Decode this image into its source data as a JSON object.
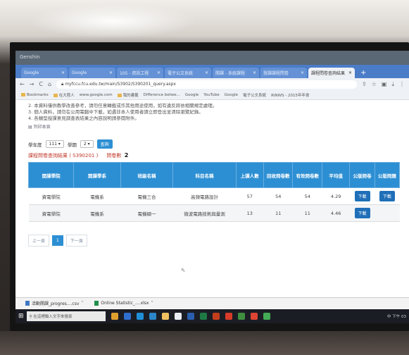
{
  "os": {
    "title": "Genshin"
  },
  "browser": {
    "tabs": [
      {
        "label": "Google",
        "active": false
      },
      {
        "label": "Google",
        "active": false
      },
      {
        "label": "105 - 資訊工程",
        "active": false
      },
      {
        "label": "電子公文系統",
        "active": false
      },
      {
        "label": "開課 - 系統課程",
        "active": false
      },
      {
        "label": "授課課程問卷",
        "active": false
      },
      {
        "label": "課程問卷查詢結果",
        "active": true
      }
    ],
    "url": "myfccu.fcu.edu.tw/main/S3902/S390201_query.aspx",
    "bookmarks": [
      "Bookmarks",
      "在大陸人",
      "www.google.com",
      "我的書籤",
      "Difference betwe...",
      "Google",
      "YouTube",
      "Google",
      "電子公文系統",
      "RINWS - 2015年年會"
    ]
  },
  "page": {
    "notes": [
      "2. 本資料僅供教學改善參考，請勿任意轉載或作其他用途使用，如有違反將依相關規定處理。",
      "3. 個人資料，請勿在公用電腦中下載，如遇非本人使用者請立即登出並清除瀏覽紀錄。",
      "4. 各類型授課意見調查表結果之內容說明請參閱附件。"
    ],
    "print_label": "列印本頁",
    "filters": {
      "year_label": "學年度",
      "year_value": "111",
      "term_label": "學期",
      "term_value": "2",
      "query_button": "查詢"
    },
    "title": "課程問卷查詢結果 ( S390201 )",
    "count_label": "問卷數",
    "count_value": "2",
    "table": {
      "headers": [
        "開課學院",
        "開課學系",
        "班級名稱",
        "科目名稱",
        "上課人數",
        "回收問卷數",
        "有效問卷數",
        "平均值",
        "公版問卷",
        "公版問題"
      ],
      "rows": [
        {
          "college": "資電學院",
          "dept": "電機系",
          "class": "電機三合",
          "course": "高頻電路設計",
          "enrolled": "57",
          "returned": "54",
          "valid": "54",
          "avg": "4.29",
          "btn1": "下載",
          "btn2": "下載"
        },
        {
          "college": "資電學院",
          "dept": "電機系",
          "class": "電機碩一",
          "course": "微波電路技術與量測",
          "enrolled": "13",
          "returned": "11",
          "valid": "11",
          "avg": "4.46",
          "btn1": "下載",
          "btn2": ""
        }
      ]
    },
    "pager": {
      "prev": "上一頁",
      "current": "1",
      "next": "下一頁"
    }
  },
  "downloads": [
    {
      "name": "活動開課_progres....csv",
      "icon": "file-icon"
    },
    {
      "name": "Online Statistic_....xlsx",
      "icon": "excel-icon"
    }
  ],
  "taskbar": {
    "search_placeholder": "在這裡輸入文字來搜尋",
    "clock": "中  下午 03"
  }
}
